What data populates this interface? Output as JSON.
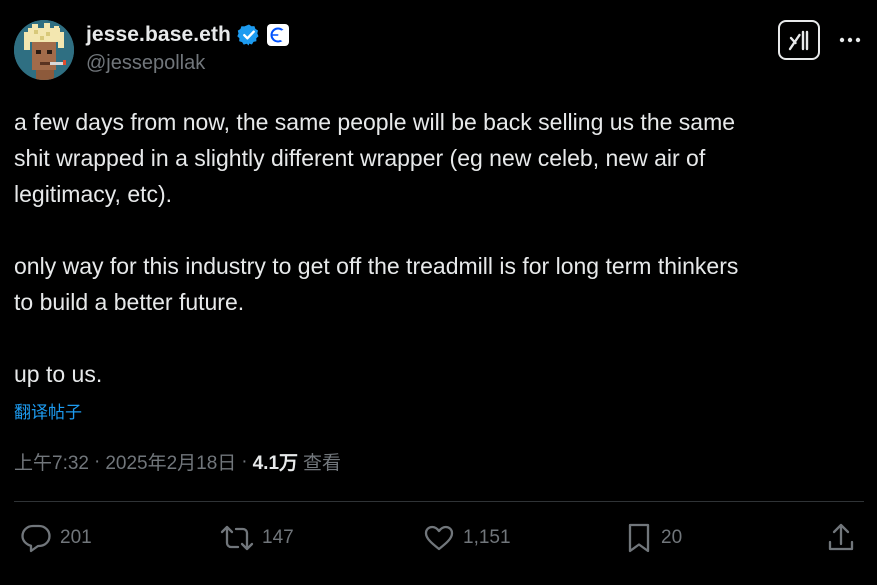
{
  "author": {
    "display_name": "jesse.base.eth",
    "handle": "@jessepollak"
  },
  "tweet": {
    "lines": [
      "a few days from now, the same people will be back selling us the same",
      "shit wrapped in a slightly different wrapper (eg new celeb, new air of",
      "legitimacy, etc).",
      "",
      "only way for this industry to get off the treadmill is for long term thinkers",
      "to build a better future.",
      "",
      "up to us."
    ],
    "translate_label": "翻译帖子",
    "time": "上午7:32",
    "date": "2025年2月18日",
    "separator": "·",
    "views_count": "4.1万",
    "views_label": "查看"
  },
  "actions": {
    "replies": "201",
    "reposts": "147",
    "likes": "1,151",
    "bookmarks": "20"
  },
  "colors": {
    "background": "#000000",
    "text": "#e7e9ea",
    "secondary": "#71767b",
    "link": "#1d9bf0",
    "verified": "#1d9bf0",
    "divider": "#2f3336"
  },
  "icons": {
    "verified": "verified-badge-icon",
    "affiliate": "base-affiliate-icon",
    "grok": "grok-icon",
    "more": "more-dots-icon",
    "reply": "reply-icon",
    "repost": "repost-icon",
    "like": "heart-icon",
    "bookmark": "bookmark-icon",
    "share": "share-icon"
  }
}
